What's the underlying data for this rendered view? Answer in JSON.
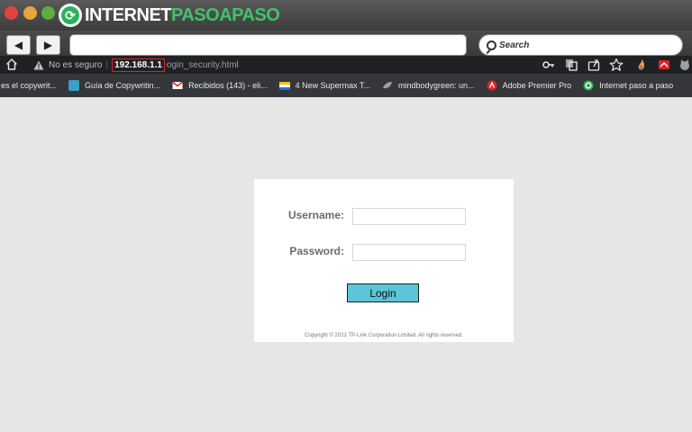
{
  "frame": {
    "brand_prefix": "INTERNET",
    "brand_accent": "PASOAPASO",
    "search_placeholder": "Search"
  },
  "address_bar": {
    "security_text": "No es seguro",
    "host": "192.168.1.1",
    "path": "ogin_security.html"
  },
  "bookmarks": [
    {
      "label": "es el copywrit...",
      "icon": "none"
    },
    {
      "label": "Guía de Copywritin...",
      "icon": "globe-icon",
      "color": "#3aa0c8"
    },
    {
      "label": "Recibidos (143) - eli...",
      "icon": "gmail-icon",
      "color": "#d93025"
    },
    {
      "label": "4 New Supermax T...",
      "icon": "flag-icon",
      "color": "#f4c20d"
    },
    {
      "label": "mindbodygreen: un...",
      "icon": "leaf-icon",
      "color": "#9aa0a6"
    },
    {
      "label": "Adobe Premier Pro",
      "icon": "adobe-icon",
      "color": "#e0222b"
    },
    {
      "label": "Internet paso a paso",
      "icon": "ipap-icon",
      "color": "#29b35a"
    }
  ],
  "login": {
    "username_label": "Username:",
    "password_label": "Password:",
    "username_value": "",
    "password_value": "",
    "button_label": "Login",
    "copyright": "Copyright © 2021 TP-Link Corporation Limited. All rights reserved."
  },
  "colors": {
    "page_bg": "#e6e6e6",
    "button_bg": "#5ac6d8",
    "highlight": "#e0222b"
  }
}
